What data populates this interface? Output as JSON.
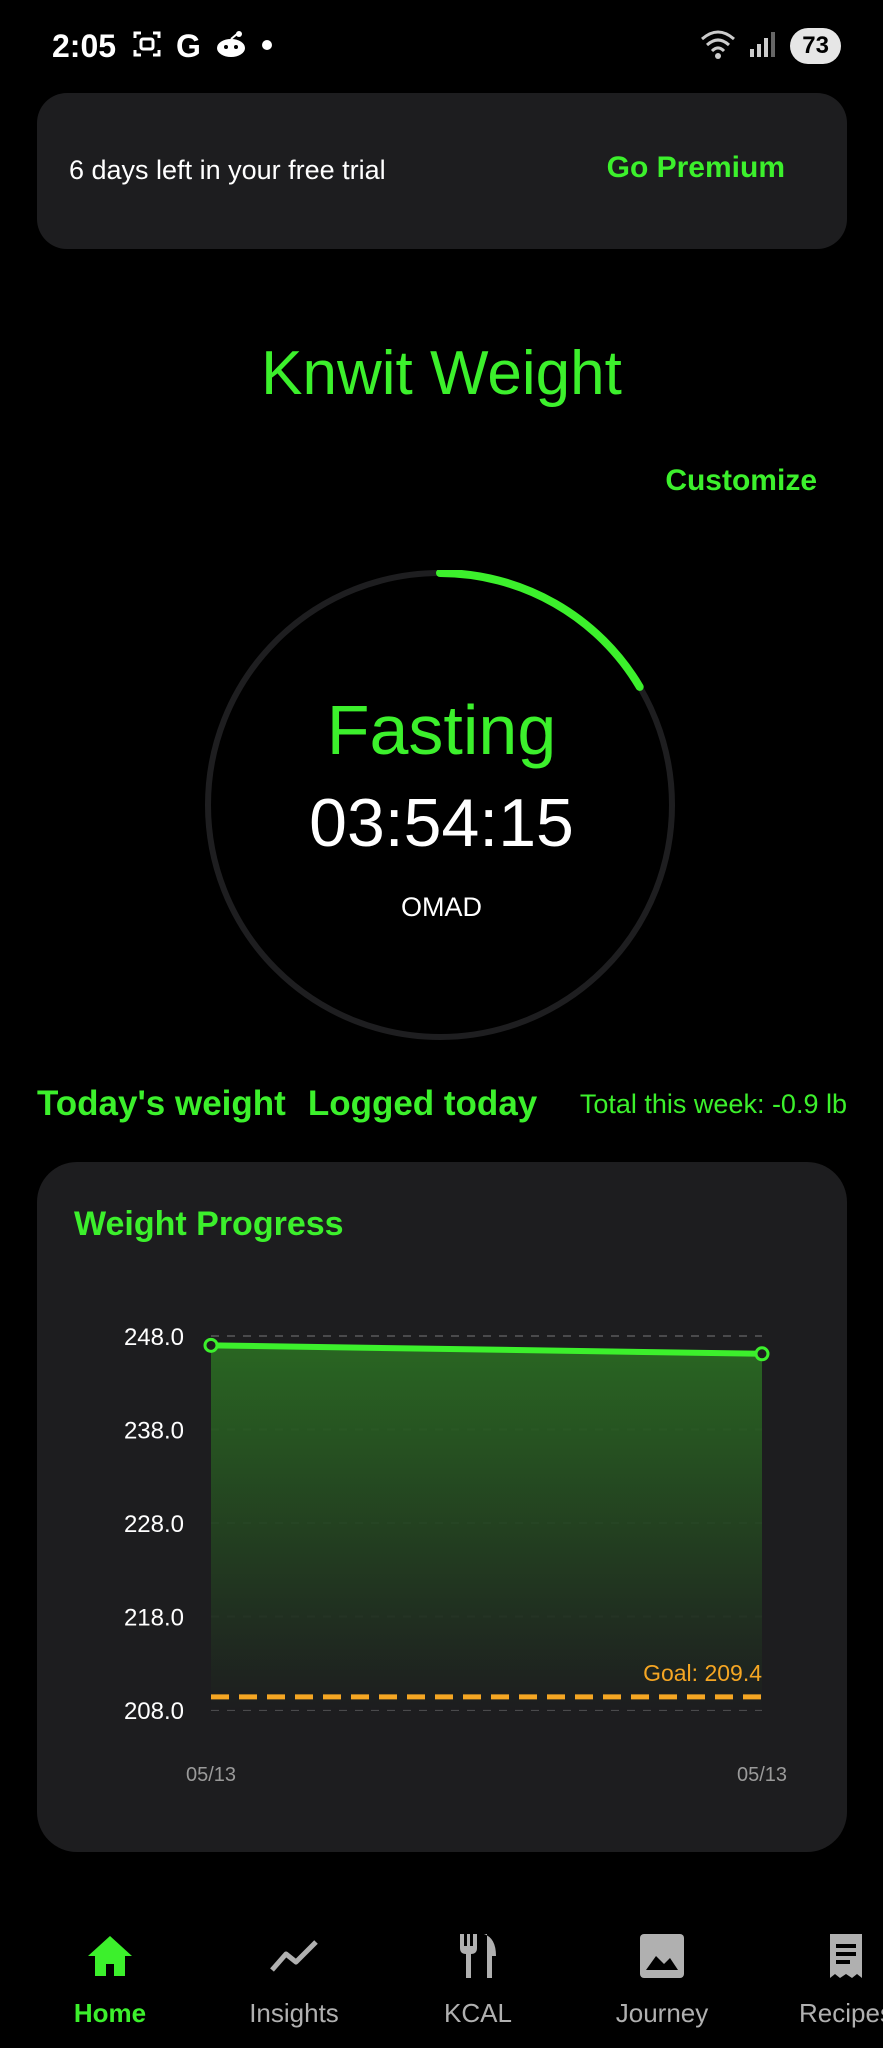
{
  "status_bar": {
    "time": "2:05",
    "left_icons": [
      "screenshot-icon",
      "google-icon",
      "reddit-icon",
      "dot-icon"
    ],
    "right_icons": [
      "wifi-icon",
      "signal-icon"
    ],
    "battery": "73"
  },
  "trial_banner": {
    "text": "6 days left in your free trial",
    "button": "Go Premium"
  },
  "app_title": "Knwit Weight",
  "customize_label": "Customize",
  "fasting": {
    "status": "Fasting",
    "timer": "03:54:15",
    "plan": "OMAD",
    "progress": 0.165
  },
  "weight_row": {
    "today_label": "Today's weight",
    "logged_label": "Logged today",
    "week_total": "Total this week: -0.9 lb"
  },
  "chart_title": "Weight Progress",
  "chart_data": {
    "type": "area",
    "title": "Weight Progress",
    "x": [
      "05/13",
      "05/13"
    ],
    "values": [
      247.0,
      246.1
    ],
    "ylim": [
      208.0,
      248.0
    ],
    "yticks": [
      "248.0",
      "238.0",
      "228.0",
      "218.0",
      "208.0"
    ],
    "xticks": [
      "05/13",
      "05/13"
    ],
    "goal": 209.4,
    "goal_label": "Goal: 209.4",
    "grid": true,
    "colors": {
      "line": "#3cf02c",
      "goal": "#f5a623"
    }
  },
  "nav": [
    {
      "label": "Home",
      "icon": "home-icon",
      "active": true
    },
    {
      "label": "Insights",
      "icon": "insights-icon",
      "active": false
    },
    {
      "label": "KCAL",
      "icon": "utensils-icon",
      "active": false
    },
    {
      "label": "Journey",
      "icon": "image-icon",
      "active": false
    },
    {
      "label": "Recipes",
      "icon": "receipt-icon",
      "active": false
    }
  ],
  "colors": {
    "accent": "#3cf02c",
    "background": "#000000",
    "card": "#1d1d1f"
  }
}
